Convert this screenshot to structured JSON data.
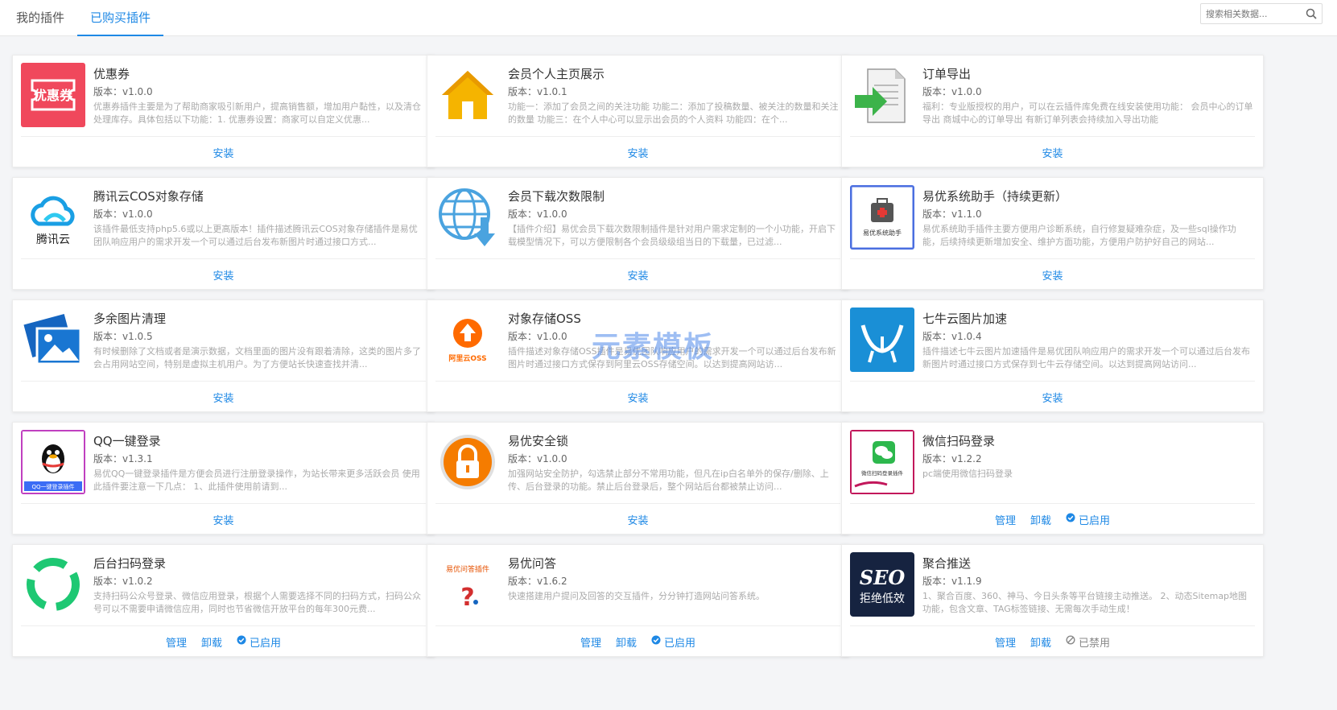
{
  "tabs": [
    {
      "label": "我的插件",
      "active": false
    },
    {
      "label": "已购买插件",
      "active": true
    }
  ],
  "search": {
    "placeholder": "搜索相关数据..."
  },
  "watermark": "元素模板",
  "colors": {
    "accent": "#1e88e5",
    "disabled": "#888888"
  },
  "plugins": [
    {
      "name": "优惠券",
      "version": "版本：v1.0.0",
      "icon": "coupon-icon",
      "desc": "优惠券插件主要是为了帮助商家吸引新用户，提高销售额，增加用户黏性，以及清仓处理库存。具体包括以下功能：1. 优惠券设置：商家可以自定义优惠...",
      "actions": [
        "安装"
      ],
      "status": ""
    },
    {
      "name": "会员个人主页展示",
      "version": "版本：v1.0.1",
      "icon": "house-icon",
      "desc": "功能一：添加了会员之间的关注功能 功能二：添加了投稿数量、被关注的数量和关注的数量 功能三：在个人中心可以显示出会员的个人资料 功能四：在个...",
      "actions": [
        "安装"
      ],
      "status": ""
    },
    {
      "name": "订单导出",
      "version": "版本：v1.0.0",
      "icon": "export-document-icon",
      "desc": "福利：专业版授权的用户，可以在云插件库免费在线安装使用功能：  会员中心的订单导出 商城中心的订单导出 有新订单列表会持续加入导出功能",
      "actions": [
        "安装"
      ],
      "status": ""
    },
    {
      "name": "腾讯云COS对象存储",
      "version": "版本：v1.0.0",
      "icon": "tencent-cloud-icon",
      "iconText": "腾讯云",
      "desc": "该插件最低支持php5.6或以上更高版本！插件描述腾讯云COS对象存储插件是易优团队响应用户的需求开发一个可以通过后台发布新图片时通过接口方式...",
      "actions": [
        "安装"
      ],
      "status": ""
    },
    {
      "name": "会员下载次数限制",
      "version": "版本：v1.0.0",
      "icon": "globe-download-icon",
      "desc": "【插件介绍】易优会员下载次数限制插件是针对用户需求定制的一个小功能，开启下载模型情况下，可以方便限制各个会员级级组当日的下载量，已过滤...",
      "actions": [
        "安装"
      ],
      "status": ""
    },
    {
      "name": "易优系统助手（持续更新）",
      "version": "版本：v1.1.0",
      "icon": "first-aid-kit-icon",
      "iconText": "易优系统助手",
      "desc": "易优系统助手插件主要方便用户诊断系统，自行修复疑难杂症，及一些sql操作功能，后续持续更新增加安全、维护方面功能，方便用户防护好自己的网站...",
      "actions": [
        "安装"
      ],
      "status": ""
    },
    {
      "name": "多余图片清理",
      "version": "版本：v1.0.5",
      "icon": "images-icon",
      "desc": "有时候删除了文档或者是演示数据，文档里面的图片没有跟着清除，这类的图片多了会占用网站空间，特别是虚拟主机用户。为了方便站长快速查找并清...",
      "actions": [
        "安装"
      ],
      "status": ""
    },
    {
      "name": "对象存储OSS",
      "version": "版本：v1.0.0",
      "icon": "aliyun-oss-icon",
      "iconText": "阿里云OSS",
      "desc": "插件描述对象存储OSS插件是易优团队响应用户的需求开发一个可以通过后台发布新图片时通过接口方式保存到阿里云OSS存储空间。以达到提高网站访...",
      "actions": [
        "安装"
      ],
      "status": ""
    },
    {
      "name": "七牛云图片加速",
      "version": "版本：v1.0.4",
      "icon": "qiniu-icon",
      "desc": "插件描述七牛云图片加速插件是易优团队响应用户的需求开发一个可以通过后台发布新图片时通过接口方式保存到七牛云存储空间。以达到提高网站访问...",
      "actions": [
        "安装"
      ],
      "status": ""
    },
    {
      "name": "QQ一键登录",
      "version": "版本：v1.3.1",
      "icon": "qq-penguin-icon",
      "iconText": "QQ一键登录插件",
      "desc": "易优QQ一键登录插件是方便会员进行注册登录操作，为站长带来更多活跃会员 使用此插件要注意一下几点： 1、此插件使用前请到...",
      "actions": [
        "安装"
      ],
      "status": ""
    },
    {
      "name": "易优安全锁",
      "version": "版本：v1.0.0",
      "icon": "lock-icon",
      "desc": "加强网站安全防护，勾选禁止部分不常用功能，但凡在ip白名单外的保存/删除、上传、后台登录的功能。禁止后台登录后，整个网站后台都被禁止访问...",
      "actions": [
        "安装"
      ],
      "status": ""
    },
    {
      "name": "微信扫码登录",
      "version": "版本：v1.2.2",
      "icon": "wechat-icon",
      "iconText": "微信扫码登录插件",
      "desc": "pc端使用微信扫码登录",
      "actions": [
        "管理",
        "卸载"
      ],
      "status": "已启用"
    },
    {
      "name": "后台扫码登录",
      "version": "版本：v1.0.2",
      "icon": "scan-login-icon",
      "desc": "支持扫码公众号登录、微信应用登录，根据个人需要选择不同的扫码方式，扫码公众号可以不需要申请微信应用，同时也节省微信开放平台的每年300元费...",
      "actions": [
        "管理",
        "卸载"
      ],
      "status": "已启用"
    },
    {
      "name": "易优问答",
      "version": "版本：v1.6.2",
      "icon": "question-icon",
      "iconText": "易优问答插件",
      "desc": "快速搭建用户提问及回答的交互插件，分分钟打造网站问答系统。",
      "actions": [
        "管理",
        "卸载"
      ],
      "status": "已启用"
    },
    {
      "name": "聚合推送",
      "version": "版本：v1.1.9",
      "icon": "seo-icon",
      "iconText": "SEO 拒绝低效",
      "iconTop": "SEO",
      "iconBottom": "拒绝低效",
      "desc": "1、聚合百度、360、神马、今日头条等平台链接主动推送。 2、动态Sitemap地图功能，包含文章、TAG标签链接、无需每次手动生成！",
      "actions": [
        "管理",
        "卸载"
      ],
      "status": "已禁用"
    }
  ]
}
